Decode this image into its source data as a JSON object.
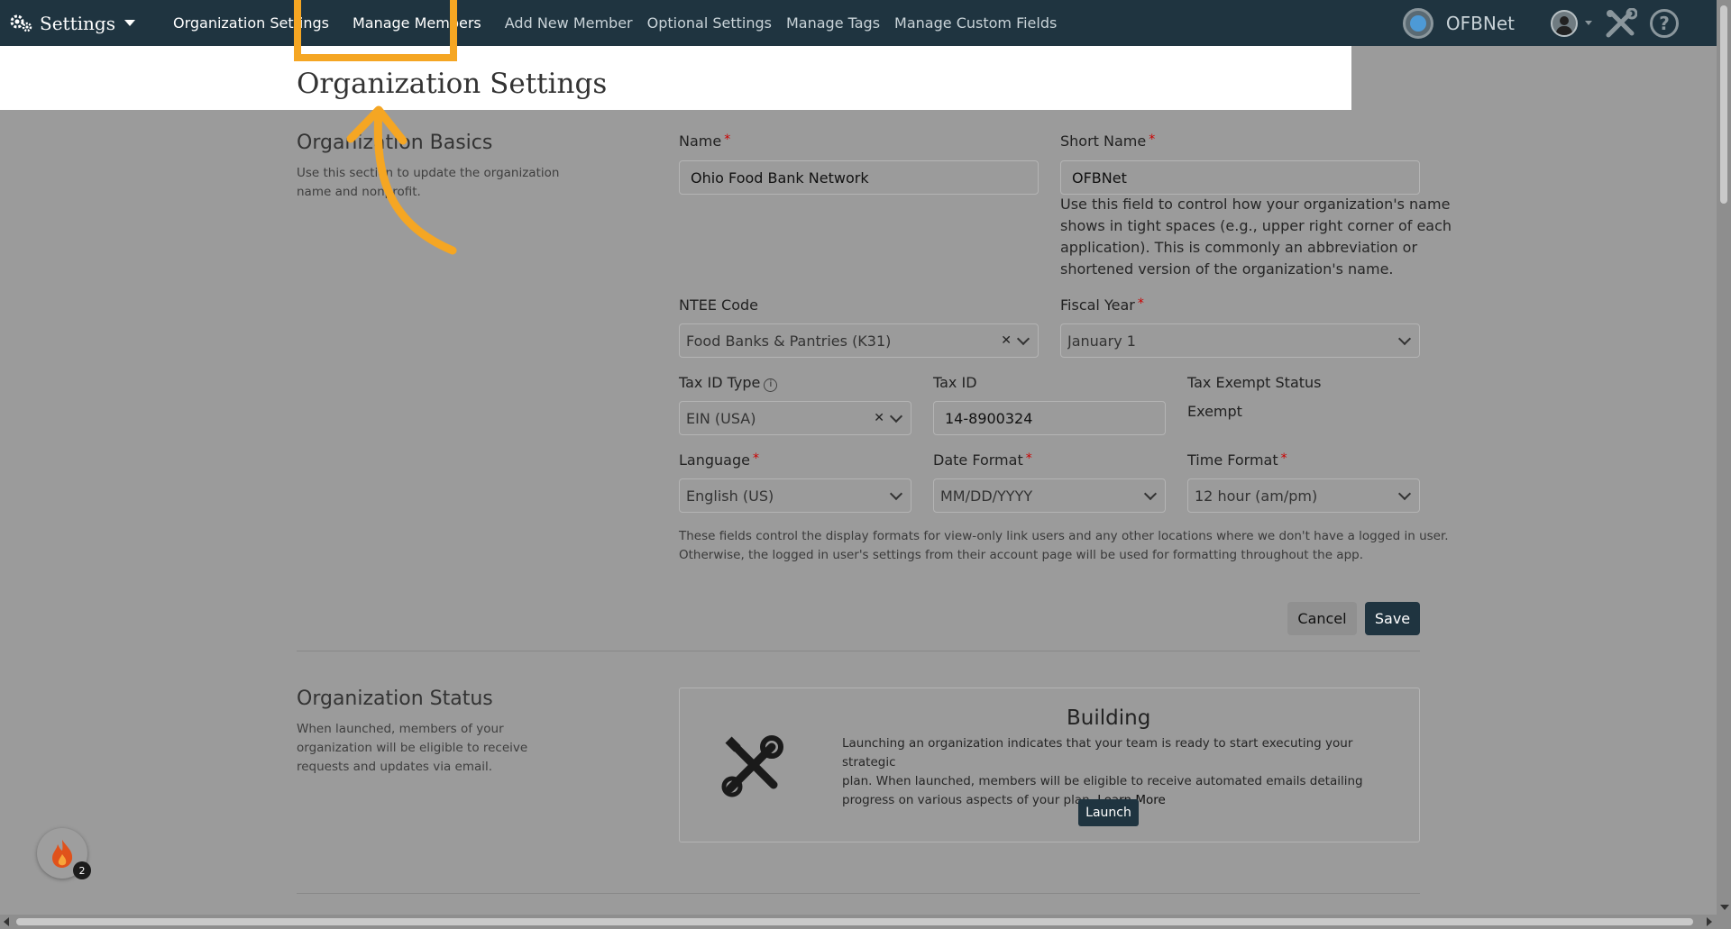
{
  "nav": {
    "brand": "Settings",
    "links": [
      "Organization Settings",
      "Manage Members",
      "Add New Member",
      "Optional Settings",
      "Manage Tags",
      "Manage Custom Fields"
    ],
    "org_name": "OFBNet"
  },
  "page_title": "Organization Settings",
  "basics": {
    "title": "Organization Basics",
    "desc_line1": "Use this section to update the organization",
    "desc_line2": "name and nonprofit.",
    "name_label": "Name",
    "name_value": "Ohio Food Bank Network",
    "short_name_label": "Short Name",
    "short_name_value": "OFBNet",
    "short_help_1": "Use this field to control how your organization's name",
    "short_help_2": "shows in tight spaces (e.g., upper right corner of each",
    "short_help_3": "application). This is commonly an abbreviation or",
    "short_help_4": "shortened version of the organization's name.",
    "ntee_label": "NTEE Code",
    "ntee_value": "Food Banks & Pantries (K31)",
    "fiscal_label": "Fiscal Year",
    "fiscal_value": "January 1",
    "taxid_type_label": "Tax ID Type",
    "taxid_type_value": "EIN (USA)",
    "taxid_label": "Tax ID",
    "taxid_value": "14-8900324",
    "taxexempt_label": "Tax Exempt Status",
    "taxexempt_value": "Exempt",
    "language_label": "Language",
    "language_value": "English (US)",
    "dateformat_label": "Date Format",
    "dateformat_value": "MM/DD/YYYY",
    "timeformat_label": "Time Format",
    "timeformat_value": "12 hour (am/pm)",
    "note_1": "These fields control the display formats for view-only link users and any other locations where we don't have a logged in user.",
    "note_2": "Otherwise, the logged in user's settings from their account page will be used for formatting throughout the app.",
    "cancel": "Cancel",
    "save": "Save"
  },
  "status": {
    "title": "Organization Status",
    "desc_1": "When launched, members of your",
    "desc_2": "organization will be eligible to receive",
    "desc_3": "requests and updates via email.",
    "state": "Building",
    "text_1": "Launching an organization indicates that your team is ready to start executing your strategic",
    "text_2": "plan. When launched, members will be eligible to receive automated emails detailing",
    "text_3": "progress on various aspects of your plan.",
    "learn_more": "Learn More",
    "launch": "Launch"
  },
  "widget": {
    "badge": "2"
  },
  "colors": {
    "nav": "#1f3440",
    "highlight": "#f5a623",
    "required": "#cc0000"
  }
}
